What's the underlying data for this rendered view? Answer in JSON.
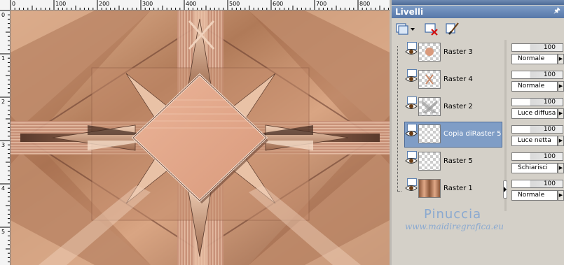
{
  "ruler": {
    "top_labels": [
      "0",
      "100",
      "200",
      "300",
      "400",
      "500",
      "600",
      "700",
      "800"
    ],
    "left_labels": [
      "0",
      "1",
      "2",
      "3",
      "4",
      "5"
    ]
  },
  "panel": {
    "title": "Livelli",
    "toolbar_icons": [
      "new-layer-icon",
      "delete-layer-icon",
      "brush-edit-icon"
    ]
  },
  "layers": [
    {
      "name": "Raster 3",
      "thumb": "dots",
      "opacity": "100",
      "blend": "Normale",
      "selected": false
    },
    {
      "name": "Raster 4",
      "thumb": "cross",
      "opacity": "100",
      "blend": "Normale",
      "selected": false
    },
    {
      "name": "Raster 2",
      "thumb": "blur",
      "opacity": "100",
      "blend": "Luce diffusa",
      "selected": false
    },
    {
      "name": "Copia diRaster 5",
      "thumb": "empty",
      "opacity": "100",
      "blend": "Luce netta",
      "selected": true
    },
    {
      "name": "Raster 5",
      "thumb": "empty",
      "opacity": "100",
      "blend": "Schiarisci",
      "selected": false
    },
    {
      "name": "Raster 1",
      "thumb": "image",
      "opacity": "100",
      "blend": "Normale",
      "selected": false
    }
  ],
  "watermark": {
    "name": "Pinuccia",
    "url": "www.maidiregrafica.eu"
  },
  "colors": {
    "accent": "#7f9dc6",
    "canvas_base": "#c99a7a",
    "diamond": "#e4a98a"
  }
}
